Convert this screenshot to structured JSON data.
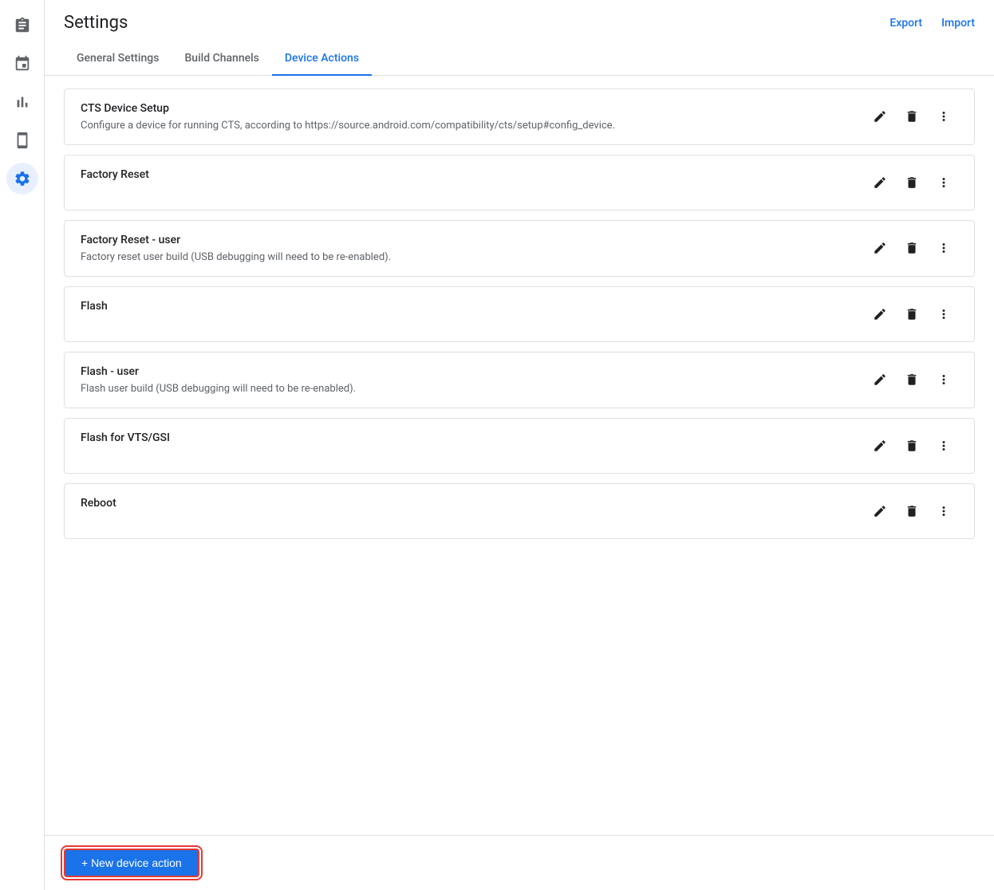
{
  "header": {
    "title": "Settings",
    "export_label": "Export",
    "import_label": "Import"
  },
  "tabs": [
    {
      "id": "general",
      "label": "General Settings",
      "active": false
    },
    {
      "id": "build-channels",
      "label": "Build Channels",
      "active": false
    },
    {
      "id": "device-actions",
      "label": "Device Actions",
      "active": true
    }
  ],
  "sidebar": {
    "items": [
      {
        "id": "clipboard",
        "icon": "clipboard",
        "active": false
      },
      {
        "id": "calendar",
        "icon": "calendar",
        "active": false
      },
      {
        "id": "chart",
        "icon": "chart",
        "active": false
      },
      {
        "id": "device",
        "icon": "device",
        "active": false
      },
      {
        "id": "settings",
        "icon": "settings",
        "active": true
      }
    ]
  },
  "actions": [
    {
      "id": "cts-device-setup",
      "title": "CTS Device Setup",
      "description": "Configure a device for running CTS, according to https://source.android.com/compatibility/cts/setup#config_device."
    },
    {
      "id": "factory-reset",
      "title": "Factory Reset",
      "description": ""
    },
    {
      "id": "factory-reset-user",
      "title": "Factory Reset - user",
      "description": "Factory reset user build (USB debugging will need to be re-enabled)."
    },
    {
      "id": "flash",
      "title": "Flash",
      "description": ""
    },
    {
      "id": "flash-user",
      "title": "Flash - user",
      "description": "Flash user build (USB debugging will need to be re-enabled)."
    },
    {
      "id": "flash-vts-gsi",
      "title": "Flash for VTS/GSI",
      "description": ""
    },
    {
      "id": "reboot",
      "title": "Reboot",
      "description": ""
    }
  ],
  "bottom": {
    "new_action_label": "+ New device action"
  },
  "colors": {
    "active_tab": "#1a73e8",
    "link": "#1a73e8",
    "new_btn_outline": "#e53935"
  }
}
